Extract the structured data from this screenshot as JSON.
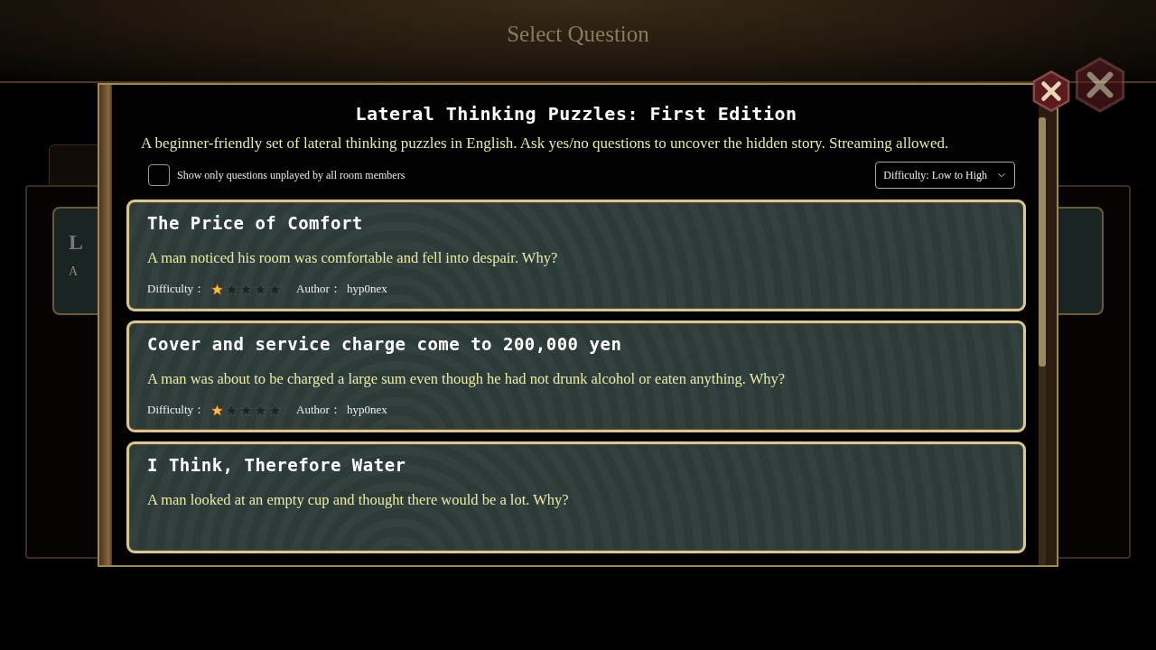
{
  "background": {
    "title": "Select Question",
    "card": {
      "title": "L",
      "subtitle": "A"
    }
  },
  "dialog": {
    "title": "Lateral Thinking Puzzles: First Edition",
    "description": "A beginner-friendly set of lateral thinking puzzles in English. Ask yes/no questions to uncover the hidden story. Streaming allowed.",
    "filter": {
      "label": "Show only questions unplayed by all room members",
      "checked": false
    },
    "sort": {
      "value": "Difficulty: Low to High"
    },
    "questions": [
      {
        "title": "The Price of Comfort",
        "description": "A man noticed his room was comfortable and fell into despair. Why?",
        "difficulty_label": "Difficulty：",
        "stars": 1,
        "author_label": "Author：",
        "author": "hyp0nex"
      },
      {
        "title": "Cover and service charge come to 200,000 yen",
        "description": "A man was about to be charged a large sum even though he had not drunk alcohol or eaten anything. Why?",
        "difficulty_label": "Difficulty：",
        "stars": 1,
        "author_label": "Author：",
        "author": "hyp0nex"
      },
      {
        "title": "I Think, Therefore Water",
        "description": "A man looked at an empty cup and thought there would be a lot. Why?"
      }
    ]
  }
}
